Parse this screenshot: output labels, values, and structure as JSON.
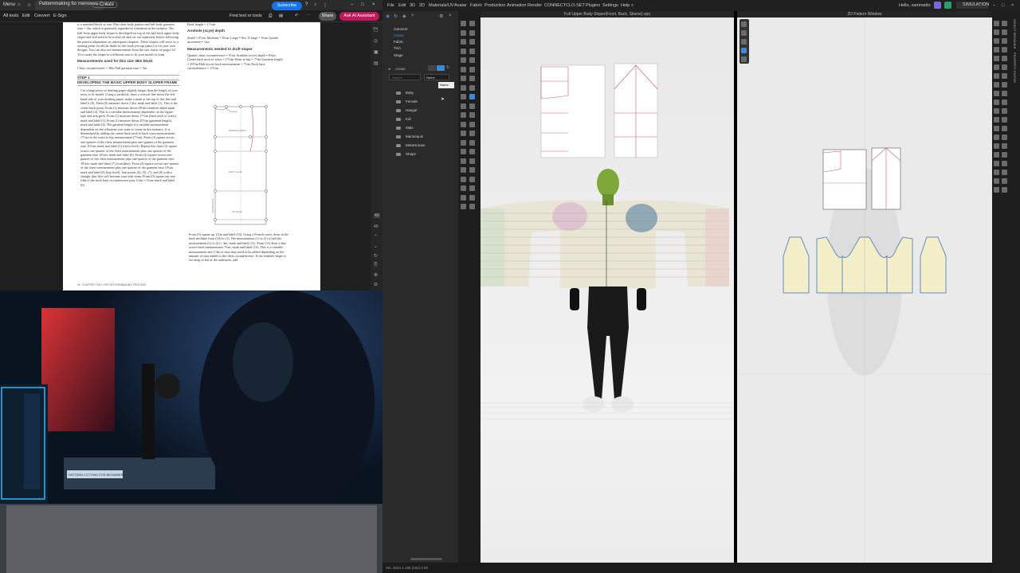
{
  "pdf_viewer": {
    "menu_label": "Menu",
    "tab_title": "Patternmaking for menswe...",
    "new_tab": "+ Create",
    "toolbar": {
      "all_tools": "All tools",
      "edit": "Edit",
      "convert": "Convert",
      "esign": "E-Sign",
      "find_text": "Find text or tools",
      "subscribe": "Subscribe",
      "share": "Share",
      "ai_assistant": "Ask AI Assistant"
    },
    "page": {
      "left_top_text": "is a standard block or size 38in chest body pattern and full body garment ease = 4in. which is generally regarded as a medium in the industry. The half front upper body sloper is developed on top of the half back upper body sloper and will need to be traced off and cut out separately before following the pattern adaptations in subsequent chapters. These slopers will serve as a starting point for all the drafts in this book (except pants) or for your own designs. You can also use measurements from the size charts on pages 32-33 to make the sloper in a different size to fit your model or form.",
      "measurements_heading": "Measurements used for this size 38in block",
      "measurements_lines": "Chest circumference = 38in  Full garment ease = 5in",
      "step_label": "STEP 1",
      "step_title": "DEVELOPING THE BASIC UPPER BODY SLOPER FRAME",
      "step_text": "Cut a large piece of drafting paper slightly longer than the length of your torso or fit model. Using a yardstick, draw a vertical line down the left-hand side of your drafting paper, make a mark at the top of this line and label it (0). From (0) measure down 1/2in, mark and label (1). This is the center back point. From (1) measure down (8¾in) armhole depth mark and label (2). This is a variable measurement dependent on the figure type and arm girth. From (1) measure down 17¼in (back neck to waist), mark and label (3). From (1) measure down 29½in (garment length), mark and label (4). The garment length is a variable measurement dependent on the silhouette you want to create in this instance. It is determined by adding the center back neck to back waist measurement, 17¼in to the waist to hip measurement (7½in). From (2) square across one-quarter of the chest measurement plus one-quarter of the garment ease 10¼in; mark and label (5) (chest level). Repeat this from (3) square across one-quarter of the chest measurement plus one-quarter of the garment ease 10¼in; mark and label (6). From (4) square across one-quarter of the chest measurement plus one-quarter of the garment ease 10¼in; mark and label (7) (waistline). From (4) square across one-quarter of the chest measurement plus one-quarter of the garment ease 10¼in mark and label (8) (hip level). Join points (6), (5), (7), and (8) with a straight line; this will become your side seam. From (0) square out one-fifth of the neck base circumference plus 1/4in = 3¼in; mark and label (9).",
      "right_top_text": "Back length = 17¼in",
      "armhole_heading": "Armhole (scye) depth",
      "armhole_text": "Small = 8½in, Medium = 8¾in, Large = 9in, X-large = 9¼in  Upside increment = ¼in",
      "draft_heading": "Measurements needed to draft sloper",
      "draft_text": "Quarter chest circumference = 9½in  Armhole (scye) depth = 8¾in  Center back neck to waist = 17¼in  Waist to hip = 7½in  Garment length = 29½in  Half across back measurement = 7¾in  Neck base circumference = 15¾in",
      "right_bottom_text": "From (9) square up 1/2in and label (10). Using a French curve, draw in the back neckline from (10) to (1). The measurement (1) to (3) is half the measurement (1) to (2) + 4in; mark and label (11). From (11) draw a line across back measurement 7¾in; mark and label (12). This is a variable measurement and 1/4in of ease may need to be added depending on the amount of ease added to the chest circumference. If the armhole shape is too deep or flat at the underarm, add",
      "footer": "CHAPTER TWO: THE PATTERNMAKING PROCESS",
      "footer_page": "40",
      "diagram_labels": [
        "ARMHOLE DEPTH",
        "WAIST LEVEL",
        "HIP LEVEL",
        "CENTER BACK"
      ]
    }
  },
  "webcam": {
    "desk_label": "PATTERN CUTTING FOR BEGINNERS"
  },
  "clo": {
    "menu_items": [
      "File",
      "Edit",
      "3D",
      "2D",
      "Materials/UV",
      "Avatar",
      "Fabric",
      "Production",
      "Animation",
      "Render",
      "CONNECT",
      "CLO-SET",
      "Plugins",
      "Settings",
      "Help"
    ],
    "user_greeting": "Hello, sammatto",
    "mode_label": "SIMULATION",
    "viewport_3d_title": "Full Upper Body Sloper(Front, Back, Sleeve).zprj",
    "viewport_2d_title": "2D Pattern Window",
    "library_tree": [
      "Garment",
      "Avatar",
      "Fabric",
      "Trim",
      "Stage"
    ],
    "sort_label": "Name",
    "sort_dropdown": "Name",
    "search_placeholder": "Search",
    "folders": [
      "Baby",
      "Female",
      "Hanger",
      "Kid",
      "Male",
      "Mannequin",
      "MetaHuman",
      "Shape"
    ],
    "right_panel_labels": [
      "OBJECT BROWSER",
      "PROPERTY EDITOR"
    ],
    "status_text": "Ver. 2024.1.186 (x64) 0.00"
  },
  "colors": {
    "subscribe_bg": "#1473e6",
    "share_bg": "#555555",
    "ai_bg": "#c2185b",
    "clo_accent": "#3a8ad8",
    "pattern_fill": "#f5efc9",
    "pattern_outline": "#5f8fc0"
  }
}
